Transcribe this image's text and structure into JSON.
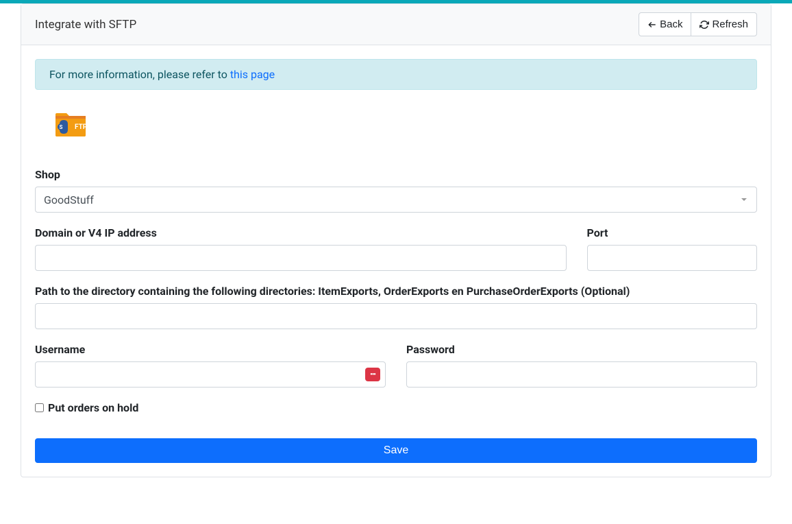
{
  "header": {
    "title": "Integrate with SFTP",
    "back_label": "Back",
    "refresh_label": "Refresh"
  },
  "alert": {
    "text_before": "For more information, please refer to ",
    "link_text": "this page"
  },
  "form": {
    "shop": {
      "label": "Shop",
      "selected": "GoodStuff"
    },
    "domain": {
      "label": "Domain or V4 IP address",
      "value": ""
    },
    "port": {
      "label": "Port",
      "value": ""
    },
    "path": {
      "label": "Path to the directory containing the following directories: ItemExports, OrderExports en PurchaseOrderExports (Optional)",
      "value": ""
    },
    "username": {
      "label": "Username",
      "value": ""
    },
    "password": {
      "label": "Password",
      "value": ""
    },
    "hold_orders": {
      "label": "Put orders on hold",
      "checked": false
    },
    "save_label": "Save"
  }
}
